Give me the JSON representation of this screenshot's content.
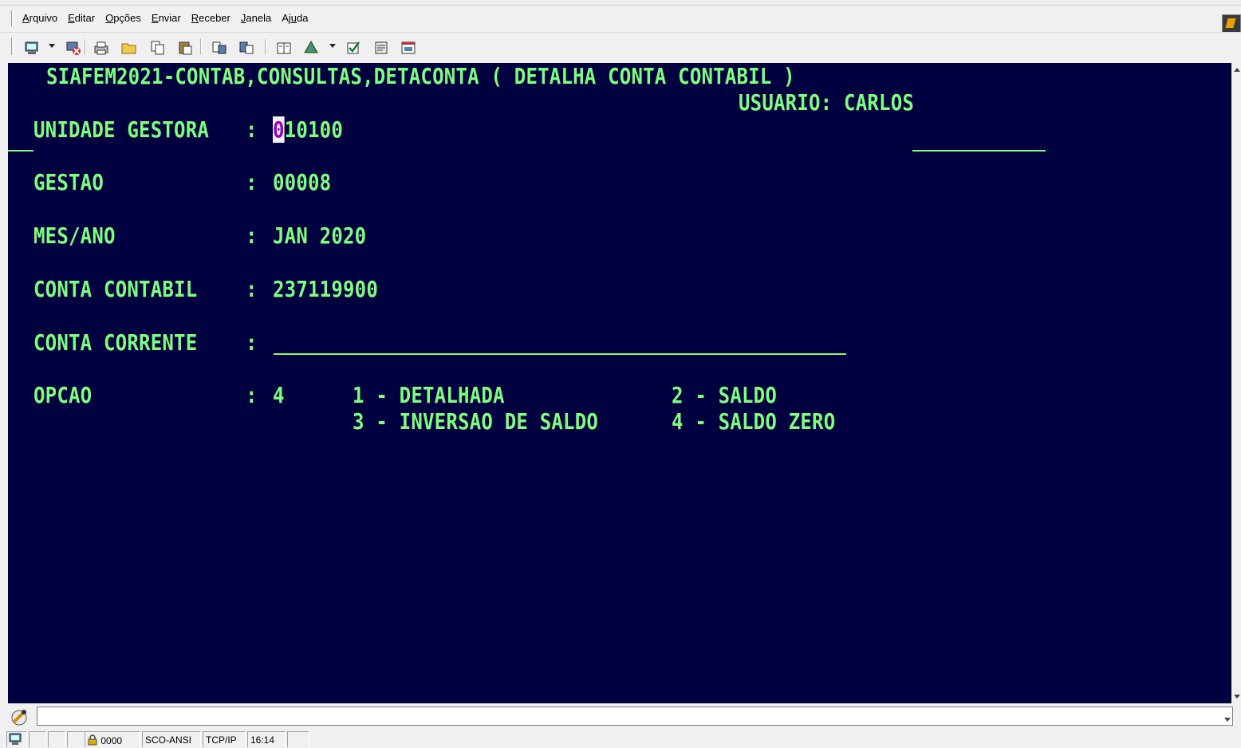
{
  "menu": {
    "items": [
      "Arquivo",
      "Editar",
      "Opções",
      "Enviar",
      "Receber",
      "Janela",
      "Ajuda"
    ]
  },
  "toolbar": {
    "buttons": [
      "terminal-icon",
      "disconnect-icon",
      "print-icon",
      "open-folder-icon",
      "copy-icon",
      "paste-icon",
      "send-file-icon",
      "receive-file-icon",
      "book-icon",
      "network-icon",
      "check-icon",
      "properties-icon",
      "screen-icon"
    ]
  },
  "terminal": {
    "header": "SIAFEM2021-CONTAB,CONSULTAS,DETACONTA ( DETALHA CONTA CONTABIL )",
    "usuario_label": "USUARIO:",
    "usuario_value": "CARLOS",
    "fields": [
      {
        "label": "UNIDADE GESTORA",
        "colon": ":",
        "value": "010100"
      },
      {
        "label": "GESTAO",
        "colon": ":",
        "value": "00008"
      },
      {
        "label": "MES/ANO",
        "colon": ":",
        "value": "JAN 2020"
      },
      {
        "label": "CONTA CONTABIL",
        "colon": ":",
        "value": "237119900"
      },
      {
        "label": "CONTA CORRENTE",
        "colon": ":",
        "value": ""
      },
      {
        "label": "OPCAO",
        "colon": ":",
        "value": "4"
      }
    ],
    "cursor_char": "0",
    "ug_rest": "10100",
    "options": {
      "opt1": "1 - DETALHADA",
      "opt2": "2 - SALDO",
      "opt3": "3 - INVERSAO DE SALDO",
      "opt4": "4 - SALDO ZERO"
    },
    "colors": {
      "background": "#000040",
      "text": "#7dff7d",
      "cursor_bg": "#f0f0f0"
    }
  },
  "status": {
    "cursor_pos": "0000",
    "terminal_type": "SCO-ANSI",
    "protocol": "TCP/IP",
    "time": "16:14"
  }
}
